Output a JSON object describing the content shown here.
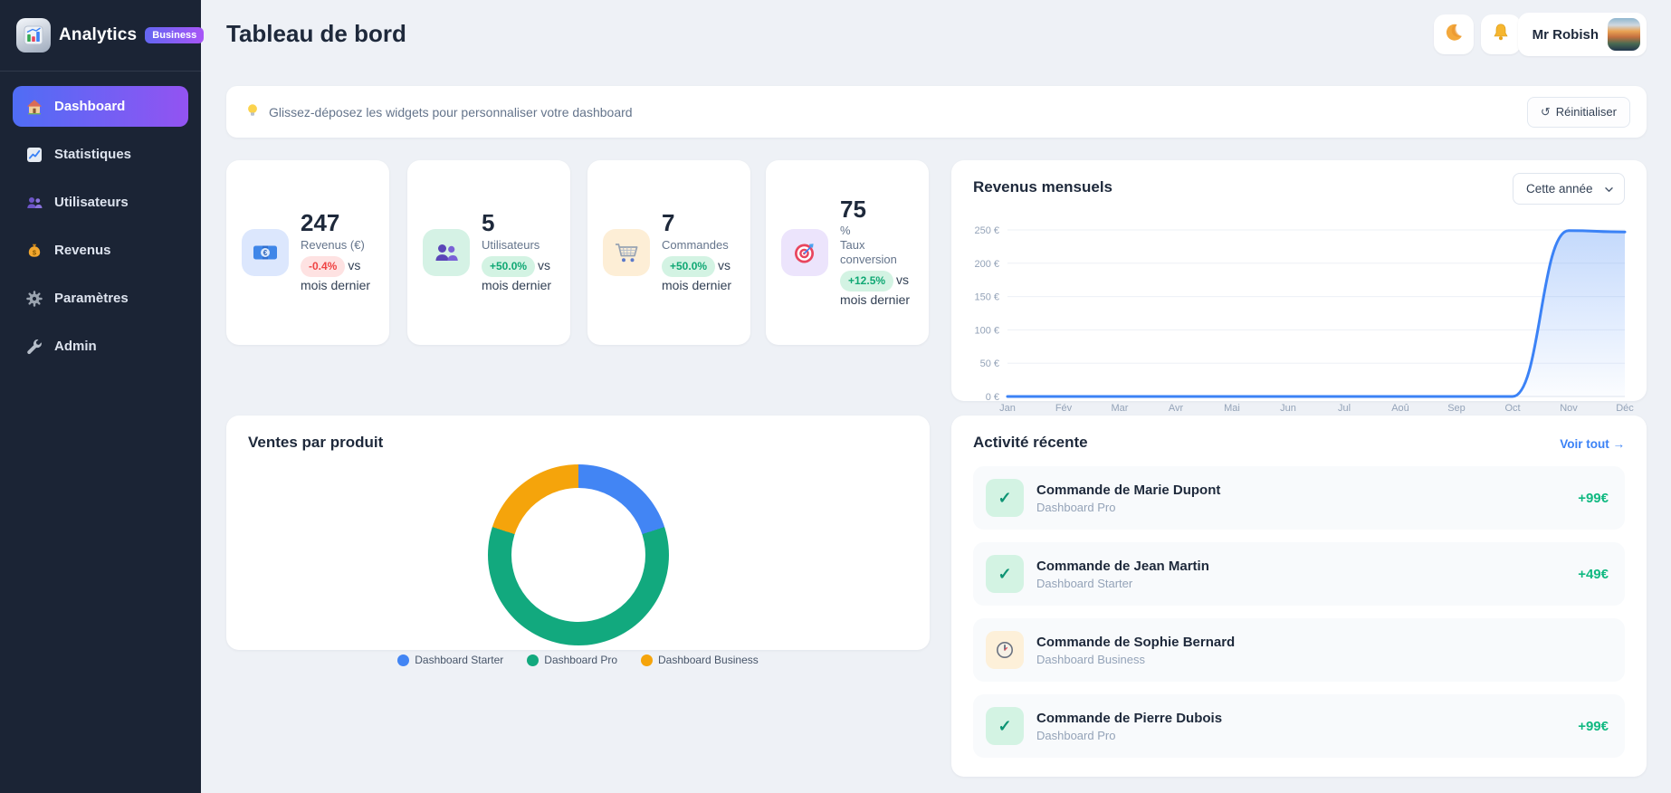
{
  "app": {
    "name": "Analytics",
    "plan_badge": "Business"
  },
  "sidebar": {
    "items": [
      {
        "label": "Dashboard",
        "icon": "home-icon",
        "active": true
      },
      {
        "label": "Statistiques",
        "icon": "chart-line-icon",
        "active": false
      },
      {
        "label": "Utilisateurs",
        "icon": "users-icon",
        "active": false
      },
      {
        "label": "Revenus",
        "icon": "money-bag-icon",
        "active": false
      },
      {
        "label": "Paramètres",
        "icon": "gear-icon",
        "active": false
      },
      {
        "label": "Admin",
        "icon": "wrench-icon",
        "active": false
      }
    ]
  },
  "header": {
    "title": "Tableau de bord",
    "user_name": "Mr Robish"
  },
  "banner": {
    "text": "Glissez-déposez les widgets pour personnaliser votre dashboard",
    "reset_label": "Réinitialiser"
  },
  "icons": {
    "reset": "↺",
    "check": "✓",
    "bulb": "lightbulb-icon",
    "moon": "moon-icon",
    "bell": "bell-icon"
  },
  "stats": [
    {
      "value": "247",
      "unit": "",
      "label": "Revenus (€)",
      "badge": "-0.4%",
      "badge_type": "negative",
      "tail": "vs mois dernier",
      "icon": "banknote-icon",
      "icon_bg": "#dce7fd"
    },
    {
      "value": "5",
      "unit": "",
      "label": "Utilisateurs",
      "badge": "+50.0%",
      "badge_type": "positive",
      "tail": "vs mois dernier",
      "icon": "users-icon",
      "icon_bg": "#d5f2e5"
    },
    {
      "value": "7",
      "unit": "",
      "label": "Commandes",
      "badge": "+50.0%",
      "badge_type": "positive",
      "tail": "vs mois dernier",
      "icon": "cart-icon",
      "icon_bg": "#fdeed6"
    },
    {
      "value": "75",
      "unit": "%",
      "label": "Taux conversion",
      "badge": "+12.5%",
      "badge_type": "positive",
      "tail": "vs mois dernier",
      "icon": "target-icon",
      "icon_bg": "#ece4fc"
    }
  ],
  "revenue_chart": {
    "select_value": "Cette année"
  },
  "activity": {
    "title": "Activité récente",
    "view_all": "Voir tout →",
    "items": [
      {
        "title": "Commande de Marie Dupont",
        "product": "Dashboard Pro",
        "amount": "+99€",
        "status": "completed"
      },
      {
        "title": "Commande de Jean Martin",
        "product": "Dashboard Starter",
        "amount": "+49€",
        "status": "completed"
      },
      {
        "title": "Commande de Sophie Bernard",
        "product": "Dashboard Business",
        "amount": "",
        "status": "pending"
      },
      {
        "title": "Commande de Pierre Dubois",
        "product": "Dashboard Pro",
        "amount": "+99€",
        "status": "completed"
      }
    ]
  },
  "chart_data": [
    {
      "type": "area",
      "title": "Revenus mensuels",
      "x": [
        "Jan",
        "Fév",
        "Mar",
        "Avr",
        "Mai",
        "Jun",
        "Jul",
        "Aoû",
        "Sep",
        "Oct",
        "Nov",
        "Déc"
      ],
      "values": [
        0,
        0,
        0,
        0,
        0,
        0,
        0,
        0,
        0,
        0,
        249,
        247
      ],
      "xlabel": "",
      "ylabel": "€",
      "ylim": [
        0,
        250
      ],
      "yticks": [
        0,
        50,
        100,
        150,
        200,
        250
      ],
      "ytick_suffix": " €",
      "line_color": "#3b82f6",
      "fill_color": "rgba(59,130,246,0.30)",
      "grid": true,
      "legend": "none"
    },
    {
      "type": "pie",
      "title": "Ventes par produit",
      "labels": [
        "Dashboard Starter",
        "Dashboard Pro",
        "Dashboard Business"
      ],
      "values_percent": [
        20,
        60,
        20
      ],
      "colors": [
        "#4285f4",
        "#12a97e",
        "#f5a40b"
      ],
      "donut": true,
      "legend_position": "bottom"
    }
  ]
}
